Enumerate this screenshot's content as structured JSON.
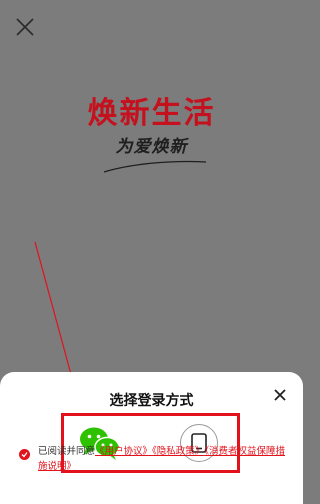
{
  "brand": {
    "title": "焕新生活",
    "slogan": "为爱焕新"
  },
  "login_sheet": {
    "title": "选择登录方式",
    "options": [
      {
        "icon": "wechat-icon"
      },
      {
        "icon": "tablet-icon"
      }
    ]
  },
  "agreement": {
    "prefix": "已阅读并同意",
    "links": [
      "《用户协议》",
      "《隐私政策》",
      "《消费者权益保障措施说明》"
    ]
  },
  "colors": {
    "accent": "#e1121c",
    "brand_red": "#c4111d",
    "wechat_green": "#2dc100",
    "overlay": "#7c7c7c"
  }
}
